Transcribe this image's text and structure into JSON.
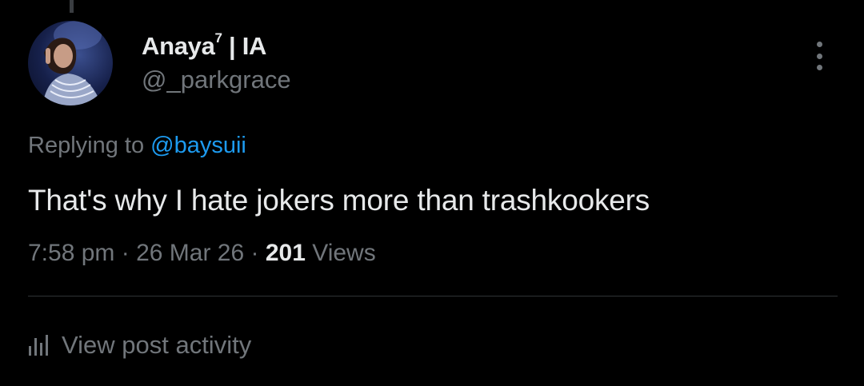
{
  "author": {
    "display_name": "Anaya",
    "display_name_sup": "7",
    "display_name_suffix": " | IA",
    "handle": "@_parkgrace"
  },
  "reply": {
    "prefix": "Replying to ",
    "mention": "@baysuii"
  },
  "tweet": {
    "text": "That's why I hate jokers more than trashkookers"
  },
  "meta": {
    "time": "7:58 pm",
    "sep1": " · ",
    "date": "26 Mar 26",
    "sep2": " · ",
    "views_count": "201",
    "views_label": " Views"
  },
  "activity": {
    "label": "View post activity",
    "icon": "bar-chart-icon"
  },
  "colors": {
    "background": "#000000",
    "text": "#e7e9ea",
    "muted": "#71767b",
    "link": "#1d9bf0",
    "divider": "#2f3336"
  }
}
